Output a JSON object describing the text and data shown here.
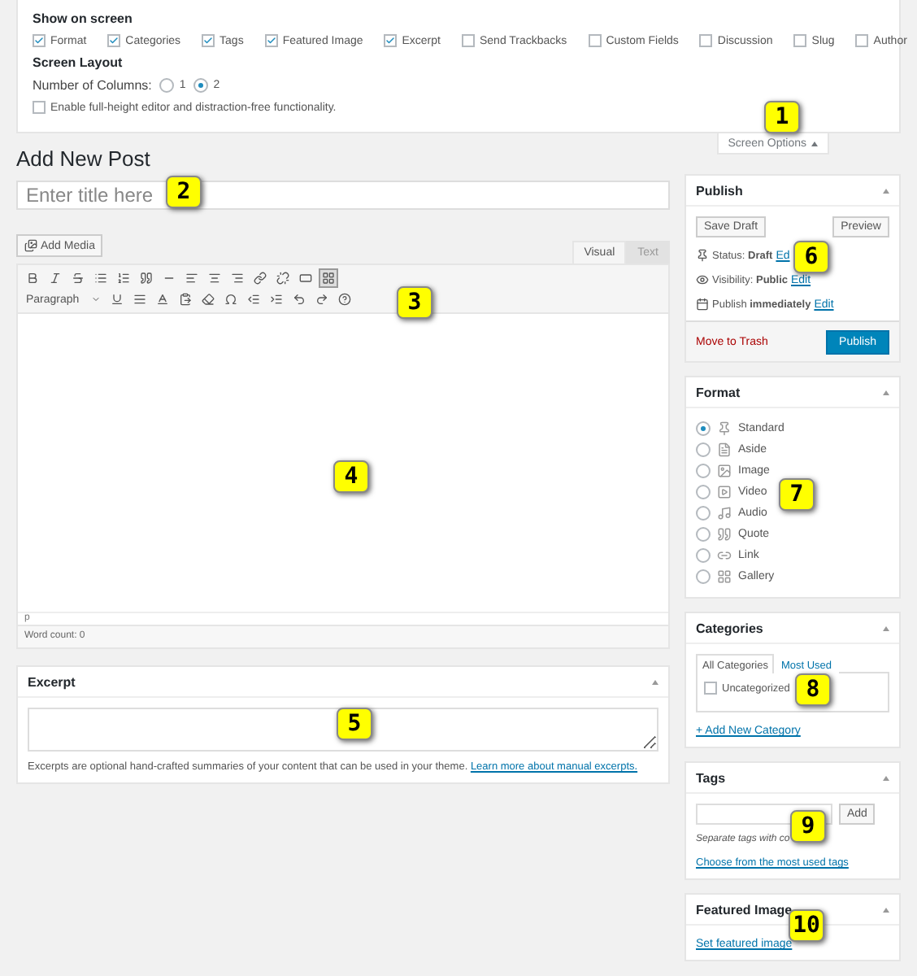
{
  "screen_options": {
    "show_heading": "Show on screen",
    "items": [
      {
        "label": "Format",
        "checked": true
      },
      {
        "label": "Categories",
        "checked": true
      },
      {
        "label": "Tags",
        "checked": true
      },
      {
        "label": "Featured Image",
        "checked": true
      },
      {
        "label": "Excerpt",
        "checked": true
      },
      {
        "label": "Send Trackbacks",
        "checked": false
      },
      {
        "label": "Custom Fields",
        "checked": false
      },
      {
        "label": "Discussion",
        "checked": false
      },
      {
        "label": "Slug",
        "checked": false
      },
      {
        "label": "Author",
        "checked": false
      }
    ],
    "layout_heading": "Screen Layout",
    "columns_label": "Number of Columns:",
    "columns": [
      {
        "label": "1",
        "selected": false
      },
      {
        "label": "2",
        "selected": true
      }
    ],
    "fullheight": {
      "label": "Enable full-height editor and distraction-free functionality.",
      "checked": false
    },
    "tab": "Screen Options"
  },
  "page_title": "Add New Post",
  "title_field": {
    "placeholder": "Enter title here"
  },
  "editor": {
    "add_media": "Add Media",
    "tabs": [
      {
        "label": "Visual",
        "selected": true
      },
      {
        "label": "Text",
        "selected": false
      }
    ],
    "toolbar_toggle_on": true,
    "format_select": "Paragraph",
    "path": "p",
    "word_count": "Word count: 0"
  },
  "excerpt": {
    "title": "Excerpt",
    "note": "Excerpts are optional hand-crafted summaries of your content that can be used in your theme.",
    "link": "Learn more about manual excerpts."
  },
  "publish": {
    "title": "Publish",
    "save_draft": "Save Draft",
    "preview": "Preview",
    "lines": [
      {
        "kind": "status",
        "text": "Status: **Draft**",
        "link": "Ed"
      },
      {
        "kind": "visibility",
        "text": "Visibility: **Public**",
        "link": "Edit"
      },
      {
        "kind": "schedule",
        "text": "Publish **immediately**",
        "link": "Edit"
      }
    ],
    "trash": "Move to Trash",
    "button": "Publish"
  },
  "format": {
    "title": "Format",
    "options": [
      {
        "kind": "standard",
        "label": "Standard",
        "selected": true
      },
      {
        "kind": "aside",
        "label": "Aside",
        "selected": false
      },
      {
        "kind": "image",
        "label": "Image",
        "selected": false
      },
      {
        "kind": "video",
        "label": "Video",
        "selected": false
      },
      {
        "kind": "audio",
        "label": "Audio",
        "selected": false
      },
      {
        "kind": "quote",
        "label": "Quote",
        "selected": false
      },
      {
        "kind": "link",
        "label": "Link",
        "selected": false
      },
      {
        "kind": "gallery",
        "label": "Gallery",
        "selected": false
      }
    ]
  },
  "categories": {
    "title": "Categories",
    "tabs": [
      {
        "label": "All Categories",
        "selected": true
      },
      {
        "label": "Most Used",
        "selected": false
      }
    ],
    "items": [
      {
        "label": "Uncategorized",
        "checked": false
      }
    ],
    "add_link": "+ Add New Category"
  },
  "tags": {
    "title": "Tags",
    "button": "Add",
    "hint": "Separate tags with co",
    "link": "Choose from the most used tags"
  },
  "featured_image": {
    "title": "Featured Image",
    "link": "Set featured image"
  },
  "callouts": [
    {
      "label": "1"
    },
    {
      "label": "2"
    },
    {
      "label": "3"
    },
    {
      "label": "4"
    },
    {
      "label": "5"
    },
    {
      "label": "6"
    },
    {
      "label": "7"
    },
    {
      "label": "8"
    },
    {
      "label": "9"
    },
    {
      "label": "10"
    }
  ]
}
